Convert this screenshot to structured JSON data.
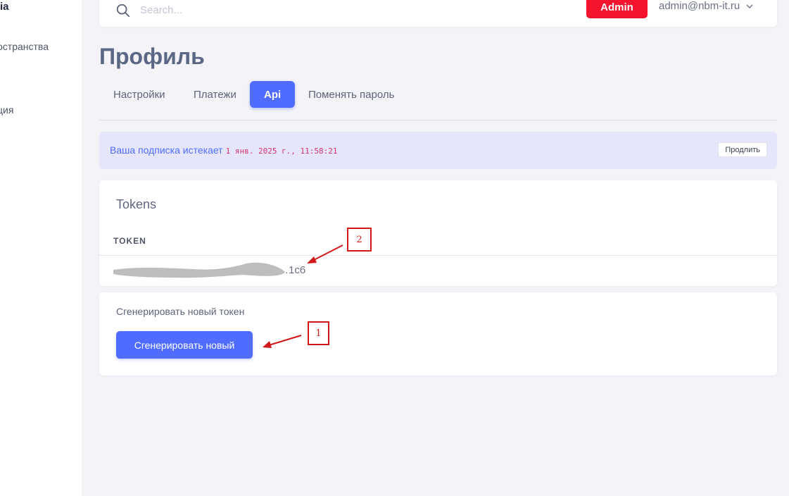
{
  "sidebar": {
    "brand": "ia",
    "items": [
      {
        "label": "остранства"
      },
      {
        "label": "ция"
      }
    ]
  },
  "header": {
    "search": {
      "placeholder": "Search..."
    },
    "admin_badge": "Admin",
    "user_email": "admin@nbm-it.ru"
  },
  "page": {
    "title": "Профиль",
    "tabs": [
      {
        "label": "Настройки",
        "active": false
      },
      {
        "label": "Платежи",
        "active": false
      },
      {
        "label": "Api",
        "active": true
      },
      {
        "label": "Поменять пароль",
        "active": false
      }
    ]
  },
  "subscription": {
    "text": "Ваша подписка истекает",
    "expires": "1 янв. 2025 г., 11:58:21",
    "extend_label": "Продлить"
  },
  "tokens_card": {
    "title": "Tokens",
    "column_header": "TOKEN",
    "rows": [
      {
        "token": "…1c6"
      }
    ]
  },
  "generate_card": {
    "label": "Сгенерировать новый токен",
    "button_label": "Сгенерировать новый"
  },
  "annotations": [
    {
      "label": "1"
    },
    {
      "label": "2"
    }
  ],
  "colors": {
    "accent": "#4f6cff",
    "admin_badge": "#f6132e",
    "annotation": "#d01818",
    "notice_bg": "#e5e6fb"
  }
}
